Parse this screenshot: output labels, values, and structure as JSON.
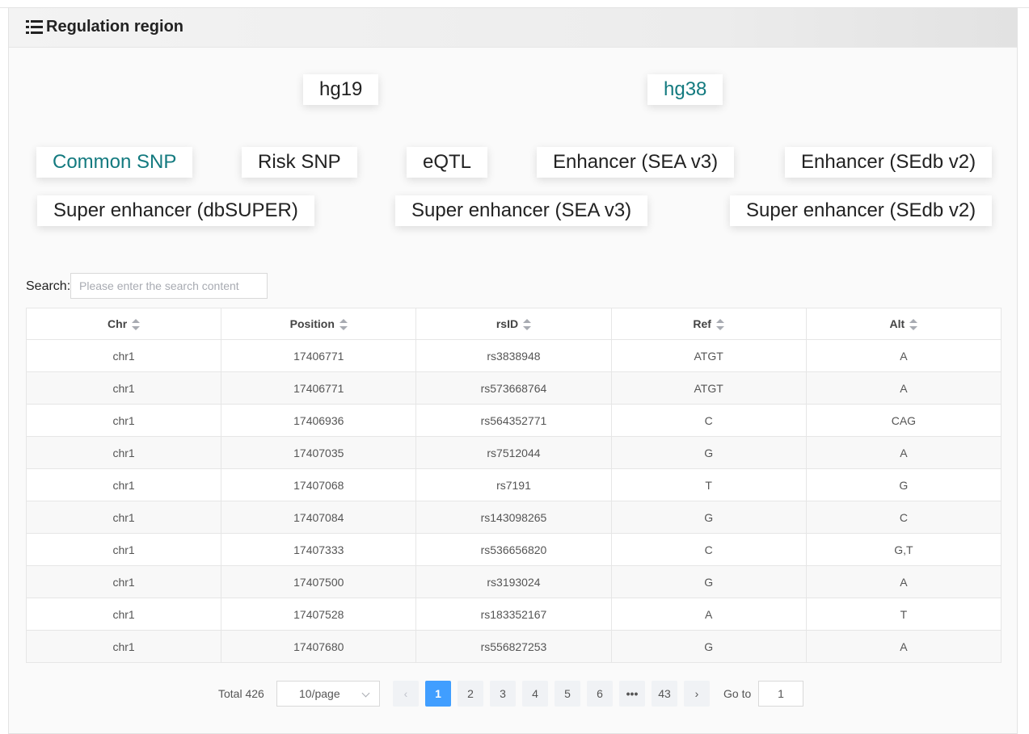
{
  "panel": {
    "title": "Regulation region",
    "icon": "list-icon"
  },
  "genome_tabs": [
    {
      "label": "hg19",
      "active": false
    },
    {
      "label": "hg38",
      "active": true
    }
  ],
  "category_tabs": [
    {
      "label": "Common SNP",
      "active": true
    },
    {
      "label": "Risk SNP",
      "active": false
    },
    {
      "label": "eQTL",
      "active": false
    },
    {
      "label": "Enhancer (SEA v3)",
      "active": false
    },
    {
      "label": "Enhancer (SEdb v2)",
      "active": false
    },
    {
      "label": "Super enhancer (dbSUPER)",
      "active": false
    },
    {
      "label": "Super enhancer (SEA v3)",
      "active": false
    },
    {
      "label": "Super enhancer (SEdb v2)",
      "active": false
    }
  ],
  "search": {
    "label": "Search:",
    "placeholder": "Please enter the search content",
    "value": ""
  },
  "table": {
    "columns": [
      "Chr",
      "Position",
      "rsID",
      "Ref",
      "Alt"
    ],
    "rows": [
      [
        "chr1",
        "17406771",
        "rs3838948",
        "ATGT",
        "A"
      ],
      [
        "chr1",
        "17406771",
        "rs573668764",
        "ATGT",
        "A"
      ],
      [
        "chr1",
        "17406936",
        "rs564352771",
        "C",
        "CAG"
      ],
      [
        "chr1",
        "17407035",
        "rs7512044",
        "G",
        "A"
      ],
      [
        "chr1",
        "17407068",
        "rs7191",
        "T",
        "G"
      ],
      [
        "chr1",
        "17407084",
        "rs143098265",
        "G",
        "C"
      ],
      [
        "chr1",
        "17407333",
        "rs536656820",
        "C",
        "G,T"
      ],
      [
        "chr1",
        "17407500",
        "rs3193024",
        "G",
        "A"
      ],
      [
        "chr1",
        "17407528",
        "rs183352167",
        "A",
        "T"
      ],
      [
        "chr1",
        "17407680",
        "rs556827253",
        "G",
        "A"
      ]
    ]
  },
  "pagination": {
    "total": "Total 426",
    "page_size": "10/page",
    "prev": "‹",
    "next": "›",
    "pages": [
      "1",
      "2",
      "3",
      "4",
      "5",
      "6",
      "•••",
      "43"
    ],
    "current_page": "1",
    "goto_label": "Go to",
    "goto_value": "1"
  },
  "colors": {
    "accent_teal": "#137a7f",
    "pager_active": "#409eff"
  }
}
